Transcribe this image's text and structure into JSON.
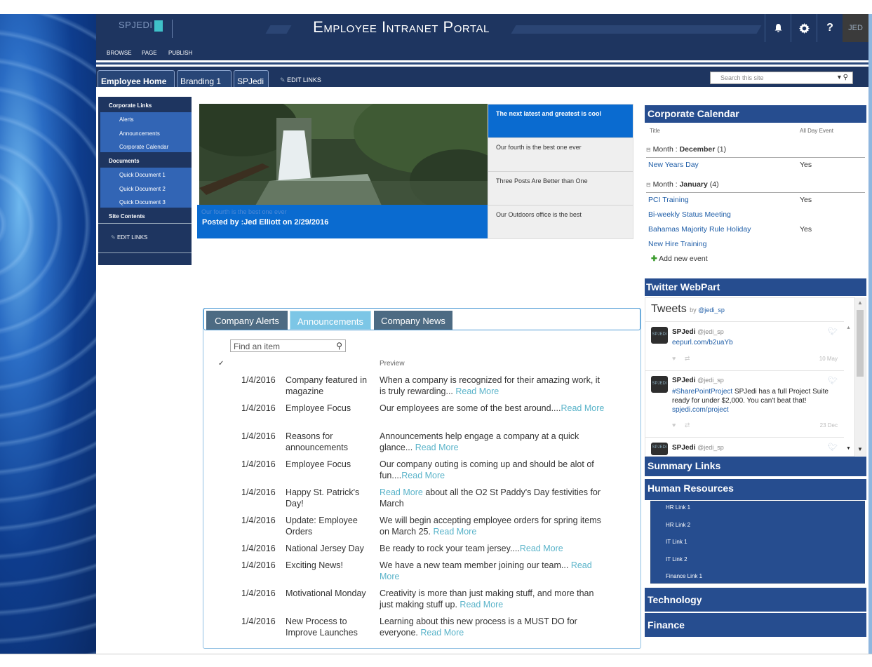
{
  "suite": {
    "logo_text": "SPJEDI",
    "portal_title": "Employee Intranet Portal",
    "icons": [
      "bell-icon",
      "gear-icon",
      "help-icon"
    ],
    "help_glyph": "?",
    "avatar_text": "JED"
  },
  "ribbon": {
    "browse": "BROWSE",
    "page": "PAGE",
    "publish": "PUBLISH"
  },
  "nav": {
    "tabs": [
      "Employee Home",
      "Branding 1",
      "SPJedi"
    ],
    "edit_links": "EDIT LINKS",
    "search_placeholder": "Search this site"
  },
  "quicklaunch": {
    "corporate_links": "Corporate Links",
    "alerts": "Alerts",
    "announcements": "Announcements",
    "corporate_calendar": "Corporate Calendar",
    "documents": "Documents",
    "doc1": "Quick Document 1",
    "doc2": "Quick Document 2",
    "doc3": "Quick Document 3",
    "site_contents": "Site Contents",
    "edit_links": "EDIT LINKS"
  },
  "hero": {
    "faint_caption": "Our fourth is the best one ever",
    "posted_by": "Posted by :Jed Elliott on 2/29/2016",
    "items": [
      "The next latest and greatest is cool",
      "Our fourth is the best one ever",
      "Three Posts Are Better than One",
      "Our Outdoors office is the best"
    ]
  },
  "tabs": {
    "alerts": "Company Alerts",
    "announcements": "Announcements",
    "news": "Company News",
    "find_placeholder": "Find an item",
    "check": "✓",
    "preview_header": "Preview",
    "read_more": "Read More",
    "rows": [
      {
        "date": "1/4/2016",
        "title": "Company featured in magazine",
        "preview": "When a company is recognized for their amazing work, it is truly rewarding... ",
        "rm_prefix": false
      },
      {
        "date": "1/4/2016",
        "title": "Employee Focus",
        "preview": "Our employees are some of the best around....",
        "rm_prefix": false
      },
      {
        "date": "1/4/2016",
        "title": "Reasons for announcements",
        "preview": "Announcements help engage a company at a quick glance... ",
        "rm_prefix": false
      },
      {
        "date": "1/4/2016",
        "title": "Employee Focus",
        "preview": "Our company outing is coming up and should be alot of fun....",
        "rm_prefix": false
      },
      {
        "date": "1/4/2016",
        "title": "Happy St. Patrick's Day!",
        "preview": " about all the O2 St Paddy's Day festivities for March",
        "rm_prefix": true
      },
      {
        "date": "1/4/2016",
        "title": "Update: Employee Orders",
        "preview": "We will begin accepting employee orders for spring items on March 25. ",
        "rm_prefix": false
      },
      {
        "date": "1/4/2016",
        "title": "National Jersey Day",
        "preview": "Be ready to rock your team jersey....",
        "rm_prefix": false
      },
      {
        "date": "1/4/2016",
        "title": "Exciting News!",
        "preview": "We have a new team member joining our team... ",
        "rm_prefix": false
      },
      {
        "date": "1/4/2016",
        "title": "Motivational Monday",
        "preview": "Creativity is more than just making stuff, and more than just making stuff up. ",
        "rm_prefix": false
      },
      {
        "date": "1/4/2016",
        "title": "New Process to Improve Launches",
        "preview": "Learning about this new process is a MUST DO for everyone. ",
        "rm_prefix": false
      }
    ]
  },
  "calendar": {
    "title": "Corporate Calendar",
    "col_title": "Title",
    "col_allday": "All Day Event",
    "month_label": "Month",
    "dec_name": "December",
    "dec_count": "(1)",
    "jan_name": "January",
    "jan_count": "(4)",
    "events": [
      {
        "title": "New Years Day",
        "allday": "Yes"
      },
      {
        "title": "PCI Training",
        "allday": "Yes"
      },
      {
        "title": "Bi-weekly Status Meeting",
        "allday": ""
      },
      {
        "title": "Bahamas Majority Rule Holiday",
        "allday": "Yes"
      },
      {
        "title": "New Hire Training",
        "allday": ""
      }
    ],
    "add_new": "Add new event"
  },
  "twitter": {
    "title": "Twitter WebPart",
    "tweets_label": "Tweets",
    "by": "by",
    "handle": "@jedi_sp",
    "tweets": [
      {
        "name": "SPJedi",
        "handle": "@jedi_sp",
        "link": "eepurl.com/b2uaYb",
        "date": "10 May"
      },
      {
        "name": "SPJedi",
        "handle": "@jedi_sp",
        "hashtag": "#SharePointProject",
        "text": " SPJedi has a full Project Suite ready for under $2,000. You can't beat that!",
        "link": "spjedi.com/project",
        "date": "23 Dec"
      },
      {
        "name": "SPJedi",
        "handle": "@jedi_sp"
      }
    ]
  },
  "summary_links": "Summary Links",
  "hr": {
    "title": "Human Resources",
    "links": [
      "HR Link 1",
      "HR Link 2",
      "IT Link 1",
      "IT Link 2",
      "Finance Link 1"
    ]
  },
  "technology": "Technology",
  "finance": "Finance"
}
